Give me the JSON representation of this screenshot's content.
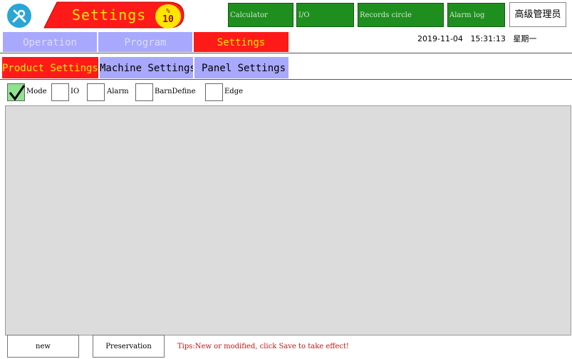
{
  "header": {
    "title": "Settings",
    "badge_percent": "%",
    "badge_value": "10",
    "function_buttons": [
      "Calculator",
      "I/O",
      "Records circle",
      "Alarm log"
    ],
    "admin_label": "高级管理员"
  },
  "main_tabs": [
    "Operation",
    "Program",
    "Settings"
  ],
  "datetime": {
    "date": "2019-11-04",
    "time": "15:31:13",
    "weekday": "星期一"
  },
  "sub_tabs": [
    "Product Settings",
    "Machine Settings",
    "Panel Settings"
  ],
  "checkboxes": [
    {
      "label": "Mode",
      "checked": true
    },
    {
      "label": "IO",
      "checked": false
    },
    {
      "label": "Alarm",
      "checked": false
    },
    {
      "label": "BarnDefine",
      "checked": false
    },
    {
      "label": "Edge",
      "checked": false
    }
  ],
  "footer": {
    "new_label": "new",
    "save_label": "Preservation",
    "tips": "Tips:New or modified, click Save to take effect!"
  },
  "colors": {
    "active_tab": "#ff1a1a",
    "inactive_tab": "#a8a8ff",
    "function_button": "#1e8f1e",
    "tips_text": "#d01010"
  }
}
